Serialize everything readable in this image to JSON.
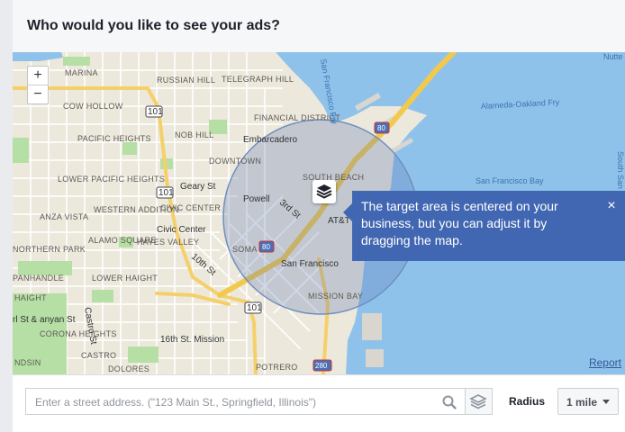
{
  "header": {
    "title": "Who would you like to see your ads?"
  },
  "map": {
    "zoom_in": "+",
    "zoom_out": "−",
    "report_label": "Report",
    "neighborhoods": [
      "MARINA",
      "RUSSIAN HILL",
      "TELEGRAPH HILL",
      "COW HOLLOW",
      "FINANCIAL DISTRICT",
      "PACIFIC HEIGHTS",
      "NOB HILL",
      "Embarcadero",
      "DOWNTOWN",
      "LOWER PACIFIC HEIGHTS",
      "SOUTH BEACH",
      "Powell",
      "WESTERN ADDITION",
      "CIVIC CENTER",
      "ANZA VISTA",
      "Civic Center",
      "AT&T Park",
      "ALAMO SQUARE",
      "HAYES VALLEY",
      "SOMA",
      "NORTHERN PARK",
      "PANHANDLE",
      "LOWER HAIGHT",
      "San Francisco",
      "HAIGHT",
      "MISSION BAY",
      "CORONA HEIGHTS",
      "16th St. Mission",
      "CASTRO",
      "DOLORES",
      "POTRERO",
      "rl St & anyan St",
      "NDSIN"
    ],
    "streets": [
      "Geary St",
      "3rd St",
      "10th St",
      "Castro St"
    ],
    "water_labels": [
      "San Francisco Bay",
      "Alameda-Oakland Fry",
      "San Francisco Fry",
      "Nutte",
      "South San Francisco"
    ],
    "shields": [
      "101",
      "80",
      "280"
    ],
    "tooltip": {
      "text": "The target area is centered on your business, but you can adjust it by dragging the map.",
      "close": "×"
    }
  },
  "search": {
    "placeholder": "Enter a street address. (\"123 Main St., Springfield, Illinois\")",
    "value": ""
  },
  "radius": {
    "label": "Radius",
    "value": "1 mile"
  },
  "colors": {
    "tooltip": "#4267b2",
    "water": "#8fc2ea",
    "land": "#ece8dc",
    "highway": "#f5d06a",
    "radius_circle": "#6f8fbf"
  }
}
